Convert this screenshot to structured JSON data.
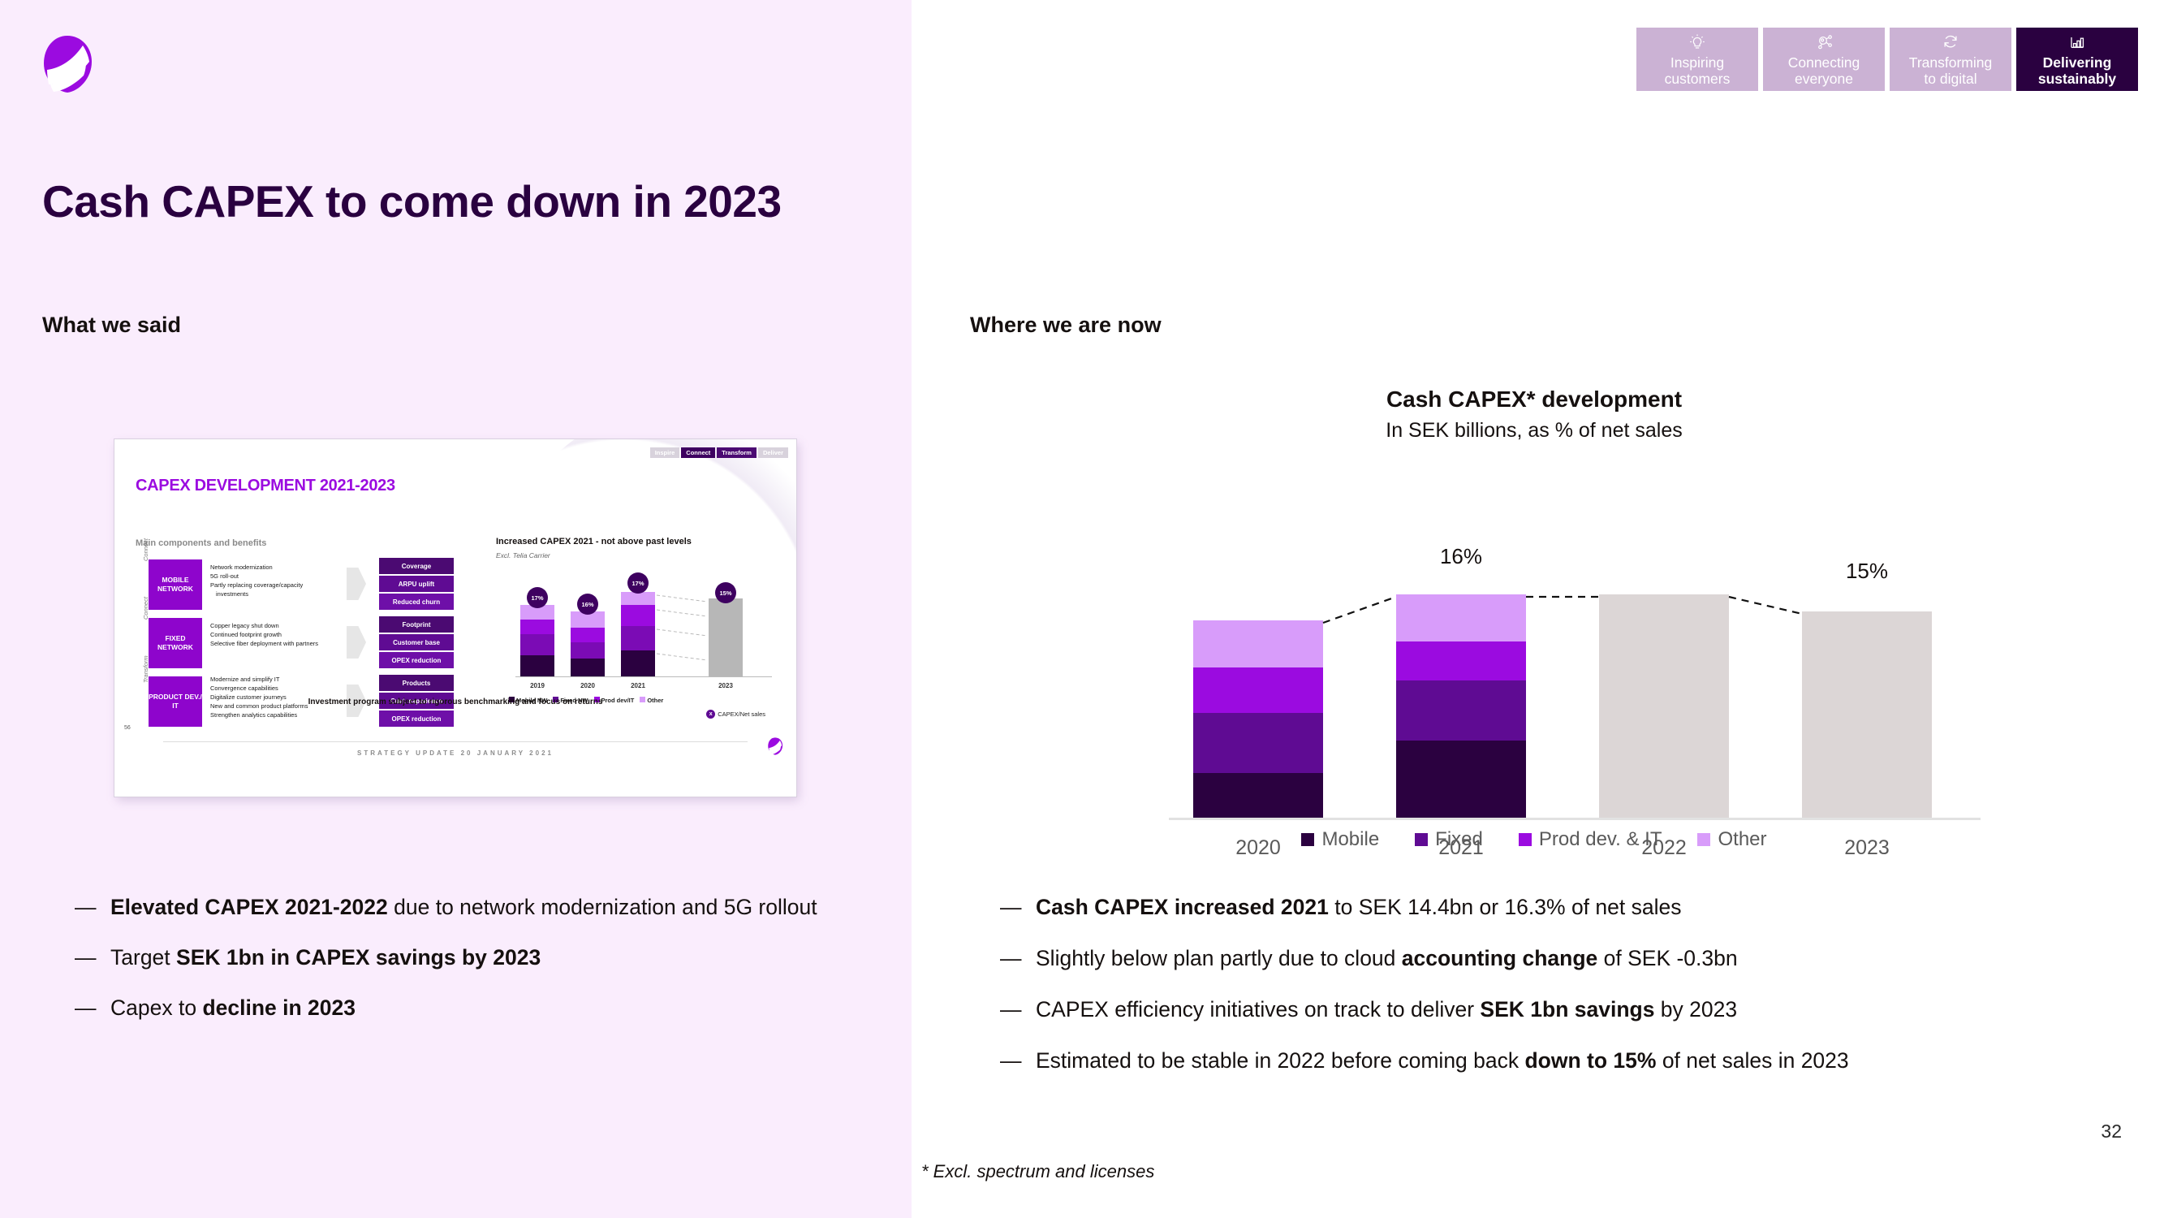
{
  "brand": {
    "logo_name": "telia-logo",
    "accent": "#9B0BE0",
    "dark": "#2A0140",
    "left_bg": "#FAEDFD"
  },
  "tabs": [
    {
      "label_line1": "Inspiring",
      "label_line2": "customers",
      "icon": "lightbulb-icon",
      "active": false
    },
    {
      "label_line1": "Connecting",
      "label_line2": "everyone",
      "icon": "network-nodes-icon",
      "active": false
    },
    {
      "label_line1": "Transforming",
      "label_line2": "to digital",
      "icon": "refresh-cycle-icon",
      "active": false
    },
    {
      "label_line1": "Delivering",
      "label_line2": "sustainably",
      "icon": "bar-chart-icon",
      "active": true
    }
  ],
  "title": "Cash CAPEX to come down in 2023",
  "sections": {
    "left_heading": "What we said",
    "right_heading": "Where we are now"
  },
  "thumbnail": {
    "title": "CAPEX DEVELOPMENT 2021-2023",
    "tabs": [
      "Inspire",
      "Connect",
      "Transform",
      "Deliver"
    ],
    "left_subtitle": "Main components and benefits",
    "right_title": "Increased CAPEX 2021 - not above past levels",
    "right_subtitle": "Excl. Telia Carrier",
    "rows": [
      {
        "side_label": "Connect",
        "box": "MOBILE NETWORK",
        "bullets": [
          "Network modernization",
          "5G roll-out",
          "Partly replacing coverage/capacity investments"
        ],
        "benefits": [
          "Coverage",
          "ARPU uplift",
          "Reduced churn"
        ]
      },
      {
        "side_label": "Connect",
        "box": "FIXED NETWORK",
        "bullets": [
          "Copper legacy shut down",
          "Continued footprint growth",
          "Selective fiber deployment with partners"
        ],
        "benefits": [
          "Footprint",
          "Customer base",
          "OPEX reduction"
        ]
      },
      {
        "side_label": "Transform",
        "box": "PRODUCT DEV./ IT",
        "bullets": [
          "Modernize and simplify IT",
          "Convergence capabilities",
          "Digitalize customer journeys",
          "New and common product platforms",
          "Strengthen analytics capabilities"
        ],
        "benefits": [
          "Products",
          "Cust. experience",
          "OPEX reduction"
        ]
      }
    ],
    "mini_chart": {
      "type": "bar",
      "categories": [
        "2019",
        "2020",
        "2021",
        "2023"
      ],
      "bubble_labels": [
        "17%",
        "16%",
        "17%",
        "15%"
      ],
      "legend": [
        "Mobile NW",
        "Fixed NW",
        "Prod dev/IT",
        "Other"
      ],
      "net_sales_note": "CAPEX/Net sales",
      "net_sales_marker": "x"
    },
    "footer_statement": "Investment program subject to rigorous benchmarking and focus on returns",
    "page_number": "56",
    "strategy_footer": "STRATEGY UPDATE 20 JANUARY 2021"
  },
  "left_bullets": [
    {
      "parts": [
        {
          "t": "Elevated CAPEX 2021-2022",
          "b": true
        },
        {
          "t": " due to network modernization and 5G rollout",
          "b": false
        }
      ]
    },
    {
      "parts": [
        {
          "t": "Target ",
          "b": false
        },
        {
          "t": "SEK 1bn in CAPEX savings by 2023",
          "b": true
        }
      ]
    },
    {
      "parts": [
        {
          "t": "Capex to ",
          "b": false
        },
        {
          "t": "decline in 2023",
          "b": true
        }
      ]
    }
  ],
  "right_bullets": [
    {
      "parts": [
        {
          "t": "Cash CAPEX increased 2021",
          "b": true
        },
        {
          "t": " to SEK 14.4bn or 16.3% of net sales",
          "b": false
        }
      ]
    },
    {
      "parts": [
        {
          "t": "Slightly below plan partly due to cloud ",
          "b": false
        },
        {
          "t": "accounting change",
          "b": true
        },
        {
          "t": " of SEK -0.3bn",
          "b": false
        }
      ]
    },
    {
      "parts": [
        {
          "t": "CAPEX efficiency initiatives on track to deliver ",
          "b": false
        },
        {
          "t": "SEK 1bn savings",
          "b": true
        },
        {
          "t": " by 2023",
          "b": false
        }
      ]
    },
    {
      "parts": [
        {
          "t": "Estimated to be stable in 2022 before coming back ",
          "b": false
        },
        {
          "t": "down to 15%",
          "b": true
        },
        {
          "t": " of net sales in 2023",
          "b": false
        }
      ]
    }
  ],
  "chart_data": {
    "type": "bar",
    "title": "Cash CAPEX* development",
    "subtitle": "In SEK billions, as % of net sales",
    "xlabel": "",
    "ylabel": "",
    "categories": [
      "2020",
      "2021",
      "2022",
      "2023"
    ],
    "stacked": true,
    "series": [
      {
        "name": "Mobile",
        "color": "#2B0140",
        "values": [
          4.6,
          5.7,
          null,
          null
        ]
      },
      {
        "name": "Fixed",
        "color": "#5F0B93",
        "values": [
          3.6,
          3.5,
          null,
          null
        ]
      },
      {
        "name": "Prod dev. & IT",
        "color": "#9B0BE0",
        "values": [
          2.3,
          2.2,
          null,
          null
        ]
      },
      {
        "name": "Other",
        "color": "#D89CFA",
        "values": [
          2.2,
          3.0,
          null,
          null
        ]
      }
    ],
    "totals": [
      12.7,
      14.4,
      14.4,
      13.4
    ],
    "projected_categories": [
      "2022",
      "2023"
    ],
    "projected_color": "#DCD6D6",
    "point_labels": [
      {
        "category": "2021",
        "text": "16%"
      },
      {
        "category": "2023",
        "text": "15%"
      }
    ],
    "legend": [
      "Mobile",
      "Fixed",
      "Prod dev. & IT",
      "Other"
    ],
    "legend_position": "bottom",
    "grid": false,
    "connectors": "dashed lines linking bar tops"
  },
  "footnote": "* Excl. spectrum and licenses",
  "page_number": "32"
}
